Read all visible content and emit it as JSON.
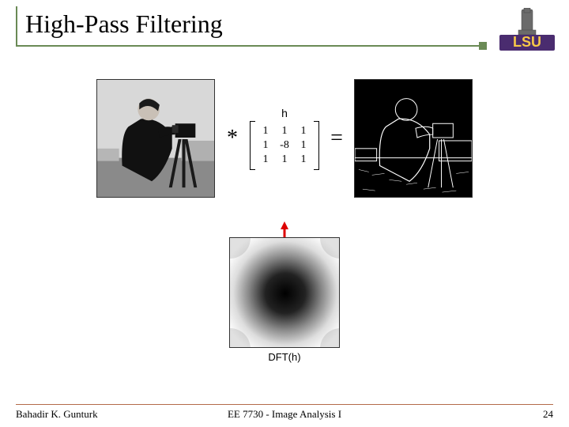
{
  "slide": {
    "title": "High-Pass Filtering",
    "kernel_label": "h",
    "kernel": {
      "r0": [
        "1",
        "1",
        "1"
      ],
      "r1": [
        "1",
        "-8",
        "1"
      ],
      "r2": [
        "1",
        "1",
        "1"
      ]
    },
    "op_conv": "*",
    "op_eq": "=",
    "dft_label": "DFT(h)"
  },
  "footer": {
    "author": "Bahadir K. Gunturk",
    "course": "EE 7730 - Image Analysis I",
    "page": "24"
  },
  "logo": {
    "text": "LSU"
  }
}
